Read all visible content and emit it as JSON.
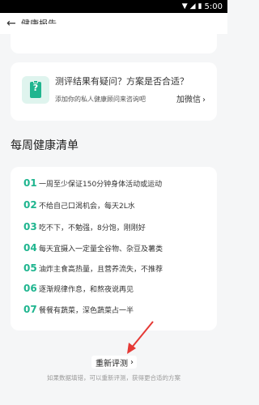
{
  "status_bar": {
    "time": "5:00"
  },
  "header": {
    "back_icon": "arrow-left-icon",
    "title": "健康报告"
  },
  "consult_card": {
    "icon": "clipboard-question-icon",
    "icon_glyph": "?",
    "title": "测评结果有疑问？方案是否合适？",
    "subtitle": "添加你的私人健康顾问来咨询吧",
    "link_label": "加微信",
    "link_chevron": "›"
  },
  "section": {
    "title": "每周健康清单"
  },
  "checklist": [
    {
      "num": "01",
      "text": "一周至少保证150分钟身体活动或运动"
    },
    {
      "num": "02",
      "text": "不给自己口渴机会，每天2L水"
    },
    {
      "num": "03",
      "text": "吃不下，不勉强，8分饱，刚刚好"
    },
    {
      "num": "04",
      "text": "每天宜摄入一定量全谷物、杂豆及薯类"
    },
    {
      "num": "05",
      "text": "油炸主食高热量，且营养流失，不推荐"
    },
    {
      "num": "06",
      "text": "逐渐规律作息，和熬夜说再见"
    },
    {
      "num": "07",
      "text": "餐餐有蔬菜，深色蔬菜占一半"
    }
  ],
  "retest": {
    "label": "重新评测",
    "chevron": "›"
  },
  "footer_note": "如果数据填错，可以重新评测，获得更合适的方案",
  "colors": {
    "accent": "#1fb58f",
    "annotation_arrow": "#e53935"
  }
}
